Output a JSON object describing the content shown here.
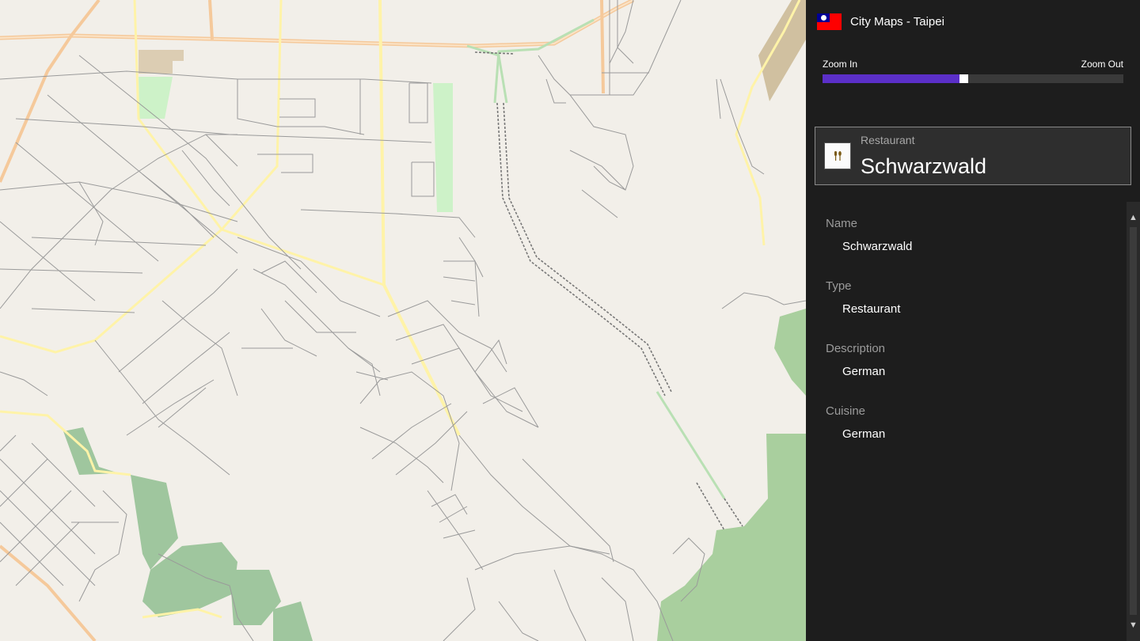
{
  "app": {
    "title": "City Maps - Taipei",
    "flag_icon": "taiwan-flag-icon"
  },
  "zoom": {
    "in_label": "Zoom In",
    "out_label": "Zoom Out",
    "level": 0.47,
    "accent": "#5b2fc8"
  },
  "selected_place": {
    "type": "Restaurant",
    "name": "Schwarzwald",
    "icon": "restaurant-icon"
  },
  "details": [
    {
      "label": "Name",
      "value": "Schwarzwald"
    },
    {
      "label": "Type",
      "value": "Restaurant"
    },
    {
      "label": "Description",
      "value": "German"
    },
    {
      "label": "Cuisine",
      "value": "German"
    }
  ],
  "map": {
    "background": "#f2efe9",
    "park_color": "#a9cf9e",
    "road_color": "#9a9a9a",
    "highway_color": "#f5c99b"
  }
}
